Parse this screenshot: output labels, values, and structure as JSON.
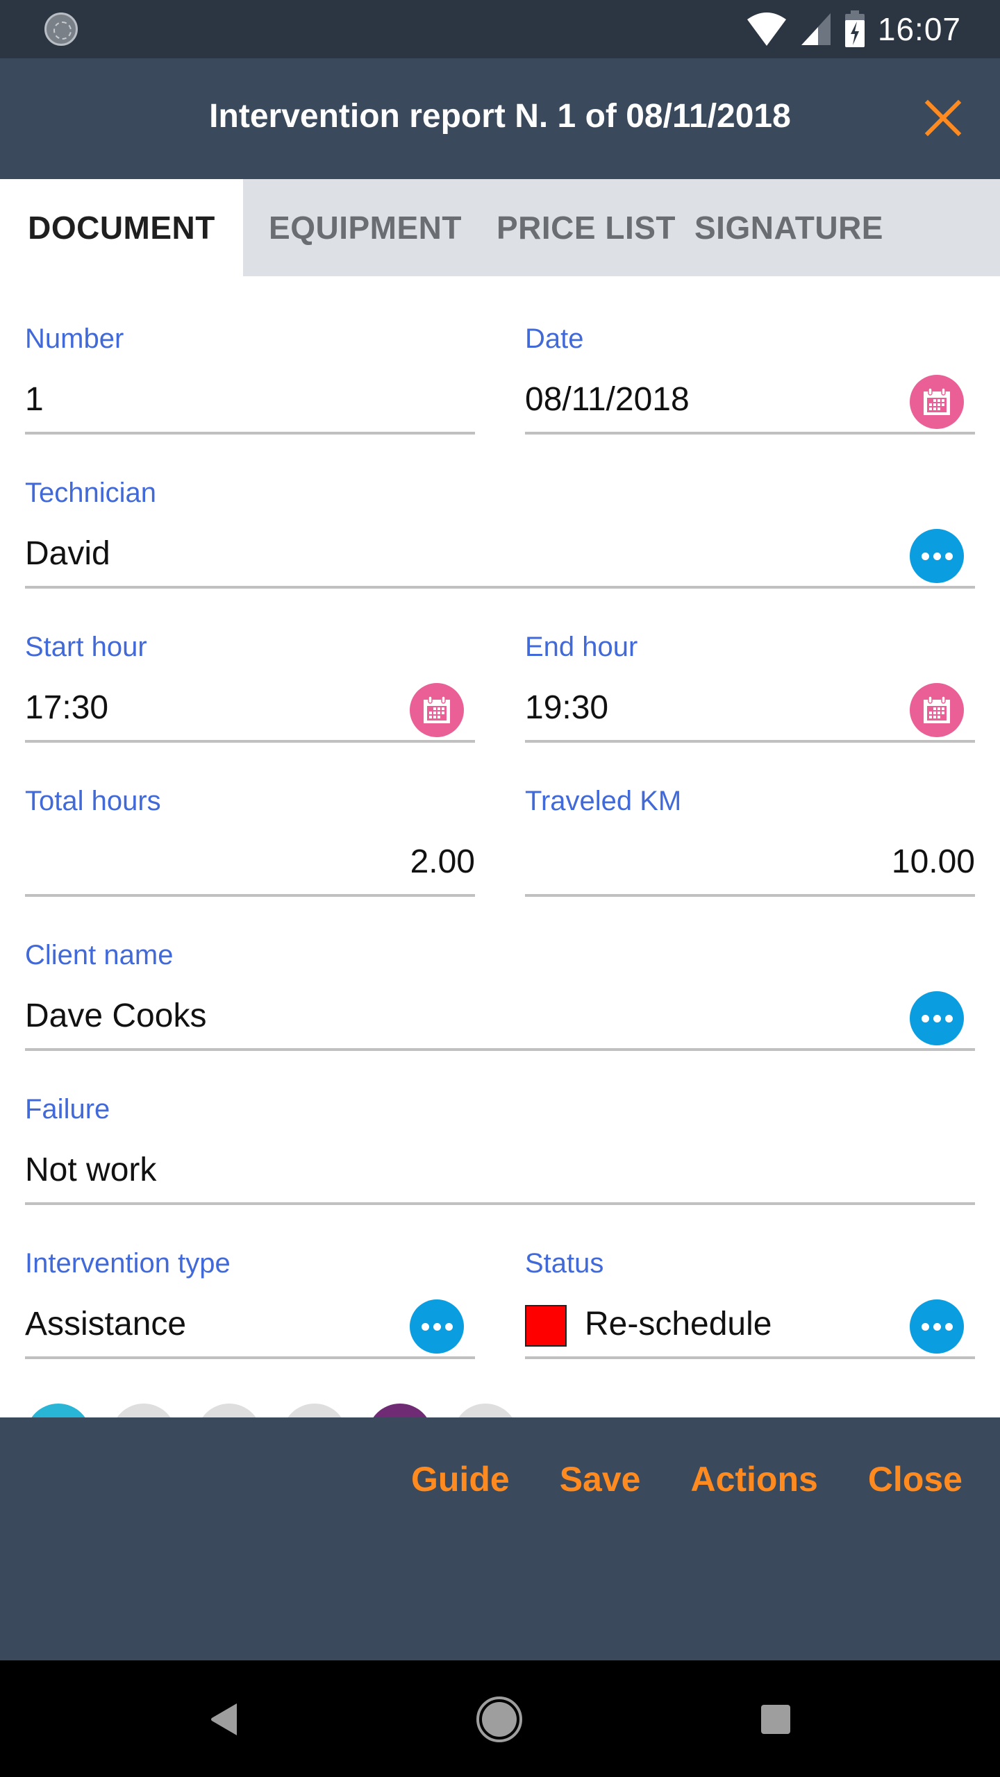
{
  "status_bar": {
    "time": "16:07",
    "icons": [
      "sync-icon",
      "wifi-icon",
      "signal-icon",
      "battery-charging-icon"
    ]
  },
  "header": {
    "title": "Intervention report N. 1 of 08/11/2018",
    "close_icon": "close-icon"
  },
  "tabs": [
    {
      "label": "DOCUMENT",
      "active": true
    },
    {
      "label": "EQUIPMENT",
      "active": false
    },
    {
      "label": "PRICE LIST",
      "active": false
    },
    {
      "label": "SIGNATURE",
      "active": false
    }
  ],
  "form": {
    "number": {
      "label": "Number",
      "value": "1"
    },
    "date": {
      "label": "Date",
      "value": "08/11/2018",
      "action_icon": "calendar-icon"
    },
    "technician": {
      "label": "Technician",
      "value": "David",
      "action_icon": "more-icon"
    },
    "start_hour": {
      "label": "Start hour",
      "value": "17:30",
      "action_icon": "calendar-icon"
    },
    "end_hour": {
      "label": "End hour",
      "value": "19:30",
      "action_icon": "calendar-icon"
    },
    "total_hours": {
      "label": "Total hours",
      "value": "2.00"
    },
    "traveled_km": {
      "label": "Traveled KM",
      "value": "10.00"
    },
    "client_name": {
      "label": "Client name",
      "value": "Dave Cooks",
      "action_icon": "more-icon"
    },
    "failure": {
      "label": "Failure",
      "value": "Not work"
    },
    "intervention_type": {
      "label": "Intervention type",
      "value": "Assistance",
      "action_icon": "more-icon"
    },
    "status": {
      "label": "Status",
      "value": "Re-schedule",
      "color": "#ff0000",
      "action_icon": "more-icon"
    }
  },
  "color_options": [
    "#29b6d6",
    "#dedede",
    "#dedede",
    "#dedede",
    "#6f2b73",
    "#dedede"
  ],
  "bottom_actions": {
    "guide": "Guide",
    "save": "Save",
    "actions": "Actions",
    "close": "Close"
  },
  "colors": {
    "accent": "#ff8a1f",
    "label": "#4169d8",
    "header_bg": "#3a4a5c",
    "calendar_button": "#ea5f96",
    "more_button": "#0a9de0"
  }
}
